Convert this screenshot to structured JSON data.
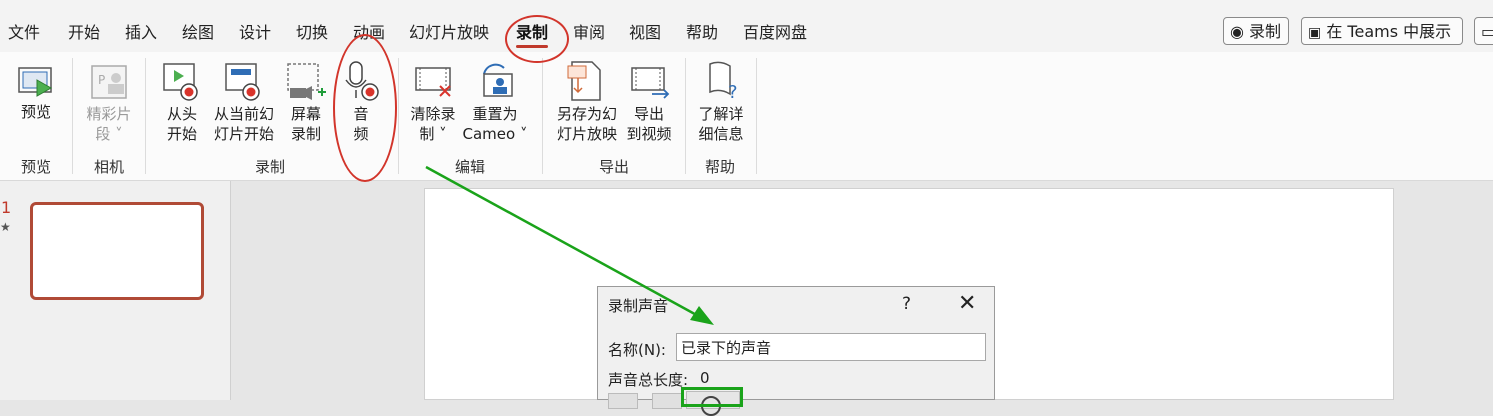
{
  "tabs": [
    "文件",
    "开始",
    "插入",
    "绘图",
    "设计",
    "切换",
    "动画",
    "幻灯片放映",
    "录制",
    "审阅",
    "视图",
    "帮助",
    "百度网盘"
  ],
  "topbar": {
    "record_btn": "◉ 录制",
    "teams_btn": "在 Teams 中展示"
  },
  "ribbon": {
    "preview": {
      "btn": "预览",
      "group": "预览"
    },
    "camera": {
      "btn_line1": "精彩片",
      "btn_line2": "段 ˅",
      "group": "相机"
    },
    "record": {
      "from_start_1": "从头",
      "from_start_2": "开始",
      "from_current_1": "从当前幻",
      "from_current_2": "灯片开始",
      "screen_1": "屏幕",
      "screen_2": "录制",
      "audio_1": "音",
      "audio_2": "频",
      "group": "录制"
    },
    "edit": {
      "clear_1": "清除录",
      "clear_2": "制 ˅",
      "reset_1": "重置为",
      "reset_2": "Cameo ˅",
      "group": "编辑"
    },
    "export": {
      "save_show_1": "另存为幻",
      "save_show_2": "灯片放映",
      "export_video_1": "导出",
      "export_video_2": "到视频",
      "group": "导出"
    },
    "help": {
      "learn_1": "了解详",
      "learn_2": "细信息",
      "group": "帮助"
    }
  },
  "slides": {
    "number": "1",
    "star": "★"
  },
  "dialog": {
    "title": "录制声音",
    "help": "?",
    "close": "✕",
    "name_label": "名称(N):",
    "name_value": "已录下的声音",
    "length_label": "声音总长度:",
    "length_value": "0"
  },
  "colors": {
    "annotation_red": "#d2352b",
    "annotation_green": "#1aa31a",
    "selection": "#b04a36"
  }
}
